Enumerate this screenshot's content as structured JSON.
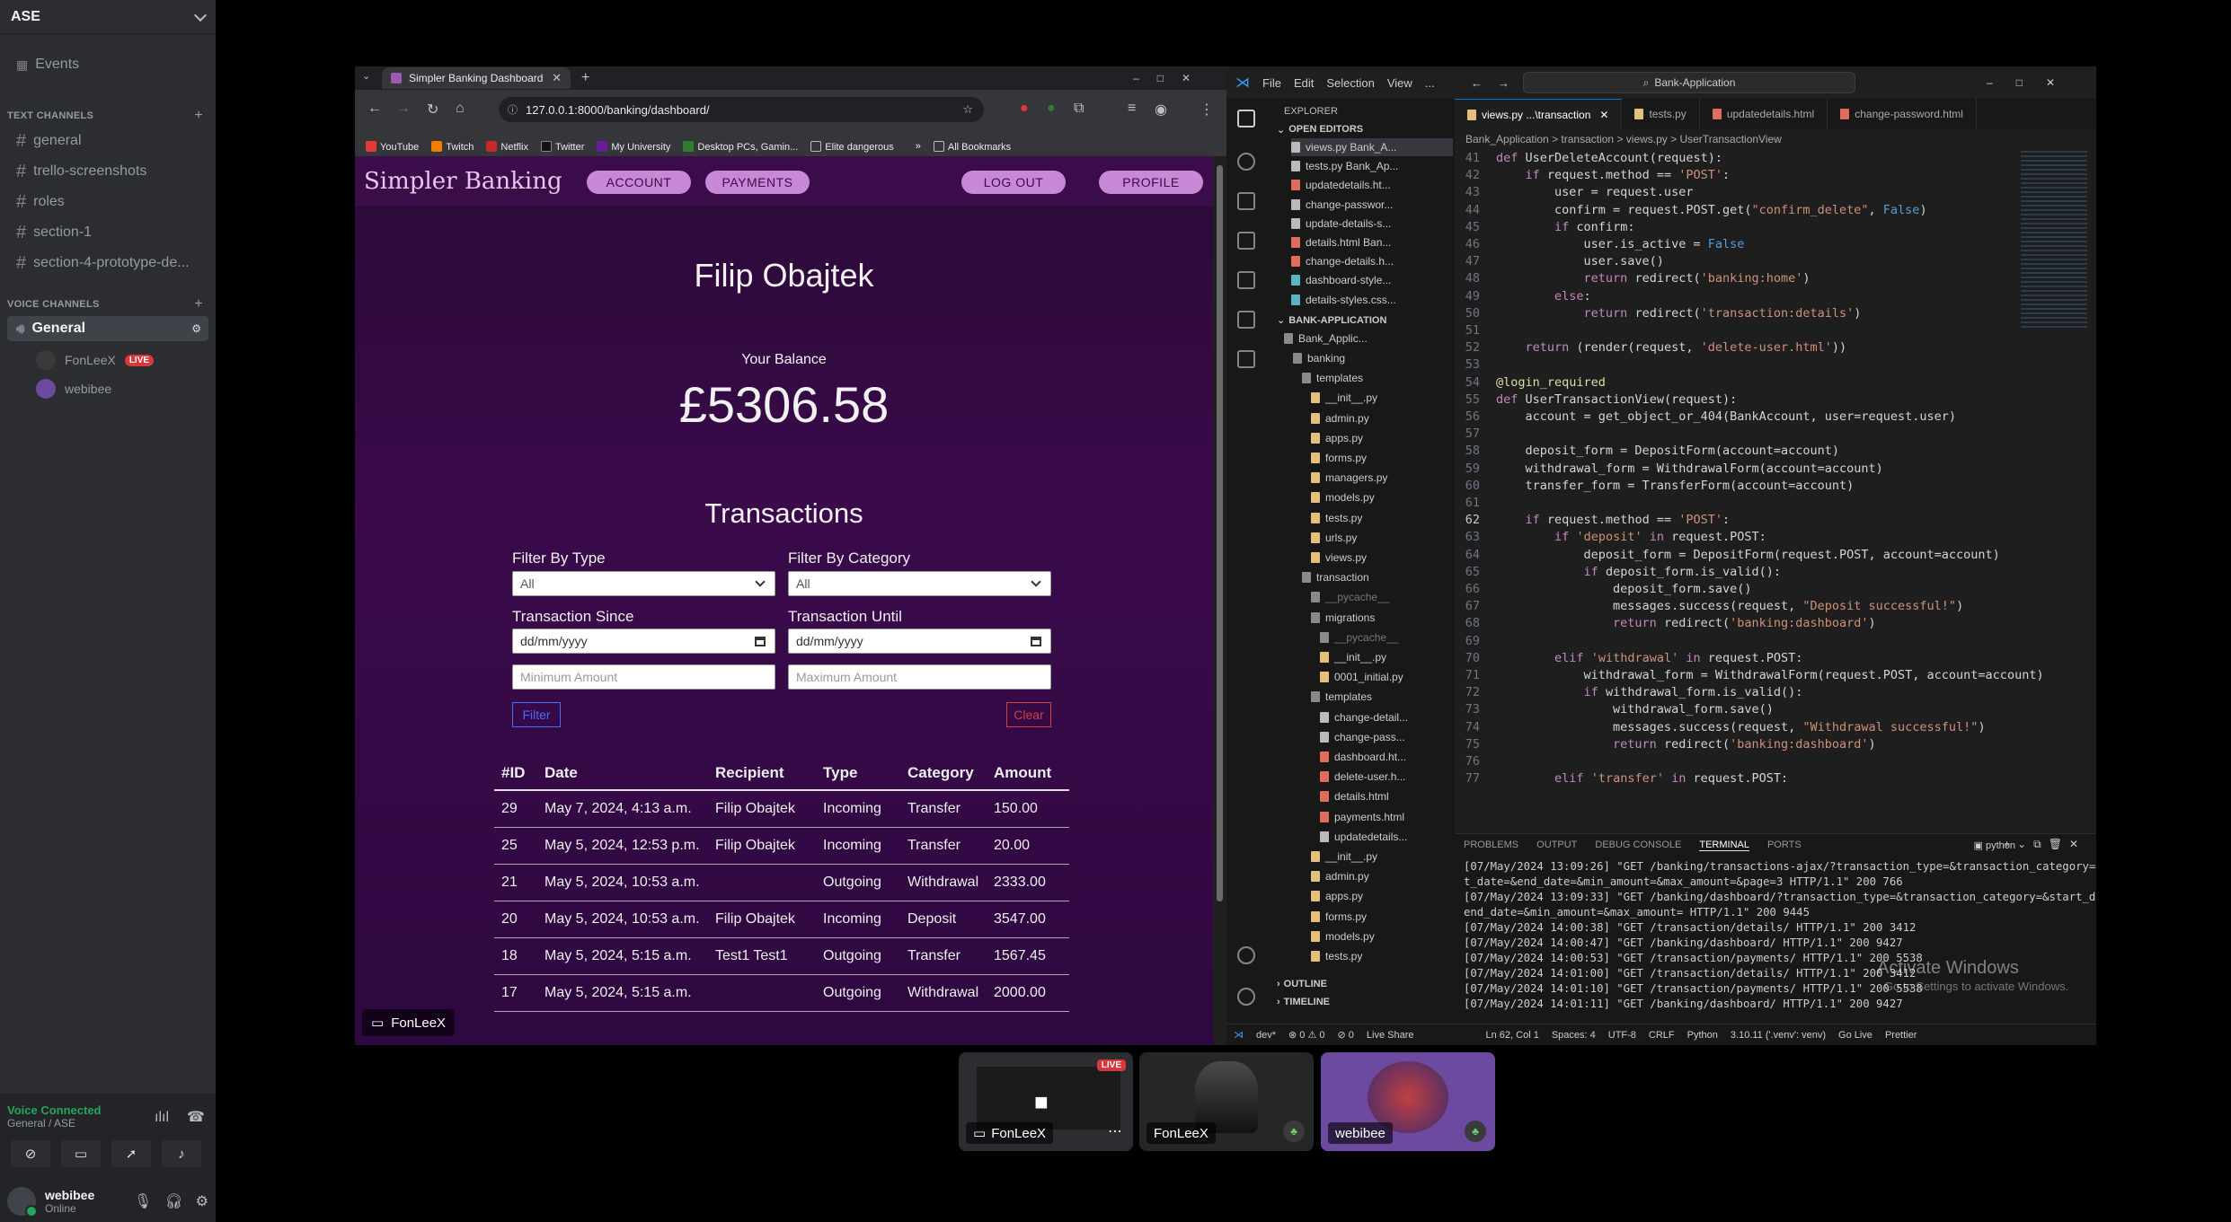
{
  "discord": {
    "server_name": "ASE",
    "events_label": "Events",
    "text_category": "TEXT CHANNELS",
    "text_channels": [
      "general",
      "trello-screenshots",
      "roles",
      "section-1",
      "section-4-prototype-de..."
    ],
    "voice_category": "VOICE CHANNELS",
    "voice_channel": "General",
    "voice_users": [
      {
        "name": "FonLeeX",
        "badge": "LIVE"
      },
      {
        "name": "webibee",
        "badge": ""
      }
    ],
    "voice_connected": "Voice Connected",
    "voice_location": "General / ASE",
    "user": {
      "name": "webibee",
      "status": "Online"
    }
  },
  "browser": {
    "tab_title": "Simpler Banking Dashboard",
    "url": "127.0.0.1:8000/banking/dashboard/",
    "bookmarks": [
      "YouTube",
      "Twitch",
      "Netflix",
      "Twitter",
      "My University",
      "Desktop PCs, Gamin...",
      "Elite dangerous",
      "All Bookmarks"
    ]
  },
  "bank": {
    "brand": "Simpler Banking",
    "nav": {
      "account": "ACCOUNT",
      "payments": "PAYMENTS",
      "logout": "LOG OUT",
      "profile": "PROFILE"
    },
    "user_name": "Filip Obajtek",
    "balance_label": "Your Balance",
    "balance": "£5306.58",
    "transactions_title": "Transactions",
    "filters": {
      "type_label": "Filter By Type",
      "type_value": "All",
      "category_label": "Filter By Category",
      "category_value": "All",
      "since_label": "Transaction Since",
      "until_label": "Transaction Until",
      "date_placeholder": "dd/mm/yyyy",
      "min_placeholder": "Minimum Amount",
      "max_placeholder": "Maximum Amount",
      "filter_btn": "Filter",
      "clear_btn": "Clear"
    },
    "table": {
      "headers": [
        "#ID",
        "Date",
        "Recipient",
        "Type",
        "Category",
        "Amount"
      ],
      "rows": [
        [
          "29",
          "May 7, 2024, 4:13 a.m.",
          "Filip Obajtek",
          "Incoming",
          "Transfer",
          "150.00"
        ],
        [
          "25",
          "May 5, 2024, 12:53 p.m.",
          "Filip Obajtek",
          "Incoming",
          "Transfer",
          "20.00"
        ],
        [
          "21",
          "May 5, 2024, 10:53 a.m.",
          "",
          "Outgoing",
          "Withdrawal",
          "2333.00"
        ],
        [
          "20",
          "May 5, 2024, 10:53 a.m.",
          "Filip Obajtek",
          "Incoming",
          "Deposit",
          "3547.00"
        ],
        [
          "18",
          "May 5, 2024, 5:15 a.m.",
          "Test1 Test1",
          "Outgoing",
          "Transfer",
          "1567.45"
        ],
        [
          "17",
          "May 5, 2024, 5:15 a.m.",
          "",
          "Outgoing",
          "Withdrawal",
          "2000.00"
        ]
      ]
    },
    "streamer_tag": "FonLeeX"
  },
  "vscode": {
    "menu": [
      "File",
      "Edit",
      "Selection",
      "View",
      "..."
    ],
    "search": "Bank-Application",
    "explorer_title": "EXPLORER",
    "open_editors": "OPEN EDITORS",
    "open_files": [
      "views.py Bank_A...",
      "tests.py Bank_Ap...",
      "updatedetails.ht...",
      "change-passwor...",
      "update-details-s...",
      "details.html Ban...",
      "change-details.h...",
      "dashboard-style...",
      "details-styles.css..."
    ],
    "project": "BANK-APPLICATION",
    "tree": [
      "Bank_Applic...",
      "banking",
      "templates",
      "__init__.py",
      "admin.py",
      "apps.py",
      "forms.py",
      "managers.py",
      "models.py",
      "tests.py",
      "urls.py",
      "views.py",
      "transaction",
      "__pycache__",
      "migrations",
      "__pycache__",
      "__init__.py",
      "0001_initial.py",
      "templates",
      "change-detail...",
      "change-pass...",
      "dashboard.ht...",
      "delete-user.h...",
      "details.html",
      "payments.html",
      "updatedetails...",
      "__init__.py",
      "admin.py",
      "apps.py",
      "forms.py",
      "models.py",
      "tests.py"
    ],
    "outline": "OUTLINE",
    "timeline": "TIMELINE",
    "tabs": [
      "views.py ...\\transaction",
      "tests.py",
      "updatedetails.html",
      "change-password.html"
    ],
    "breadcrumbs": "Bank_Application > transaction > views.py > UserTransactionView",
    "code": [
      {
        "n": "41",
        "t": "def UserDeleteAccount(request):"
      },
      {
        "n": "42",
        "t": "    if request.method == 'POST':"
      },
      {
        "n": "43",
        "t": "        user = request.user"
      },
      {
        "n": "44",
        "t": "        confirm = request.POST.get(\"confirm_delete\", False)"
      },
      {
        "n": "45",
        "t": "        if confirm:"
      },
      {
        "n": "46",
        "t": "            user.is_active = False"
      },
      {
        "n": "47",
        "t": "            user.save()"
      },
      {
        "n": "48",
        "t": "            return redirect('banking:home')"
      },
      {
        "n": "49",
        "t": "        else:"
      },
      {
        "n": "50",
        "t": "            return redirect('transaction:details')"
      },
      {
        "n": "51",
        "t": ""
      },
      {
        "n": "52",
        "t": "    return (render(request, 'delete-user.html'))"
      },
      {
        "n": "53",
        "t": ""
      },
      {
        "n": "54",
        "t": "@login_required"
      },
      {
        "n": "55",
        "t": "def UserTransactionView(request):"
      },
      {
        "n": "56",
        "t": "    account = get_object_or_404(BankAccount, user=request.user)"
      },
      {
        "n": "57",
        "t": ""
      },
      {
        "n": "58",
        "t": "    deposit_form = DepositForm(account=account)"
      },
      {
        "n": "59",
        "t": "    withdrawal_form = WithdrawalForm(account=account)"
      },
      {
        "n": "60",
        "t": "    transfer_form = TransferForm(account=account)"
      },
      {
        "n": "61",
        "t": ""
      },
      {
        "n": "62",
        "t": "    if request.method == 'POST':"
      },
      {
        "n": "63",
        "t": "        if 'deposit' in request.POST:"
      },
      {
        "n": "64",
        "t": "            deposit_form = DepositForm(request.POST, account=account)"
      },
      {
        "n": "65",
        "t": "            if deposit_form.is_valid():"
      },
      {
        "n": "66",
        "t": "                deposit_form.save()"
      },
      {
        "n": "67",
        "t": "                messages.success(request, \"Deposit successful!\")"
      },
      {
        "n": "68",
        "t": "                return redirect('banking:dashboard')"
      },
      {
        "n": "69",
        "t": ""
      },
      {
        "n": "70",
        "t": "        elif 'withdrawal' in request.POST:"
      },
      {
        "n": "71",
        "t": "            withdrawal_form = WithdrawalForm(request.POST, account=account)"
      },
      {
        "n": "72",
        "t": "            if withdrawal_form.is_valid():"
      },
      {
        "n": "73",
        "t": "                withdrawal_form.save()"
      },
      {
        "n": "74",
        "t": "                messages.success(request, \"Withdrawal successful!\")"
      },
      {
        "n": "75",
        "t": "                return redirect('banking:dashboard')"
      },
      {
        "n": "76",
        "t": ""
      },
      {
        "n": "77",
        "t": "        elif 'transfer' in request.POST:"
      }
    ],
    "panel_tabs": [
      "PROBLEMS",
      "OUTPUT",
      "DEBUG CONSOLE",
      "TERMINAL",
      "PORTS"
    ],
    "terminal_shell": "python",
    "terminal": [
      "[07/May/2024 13:09:26] \"GET /banking/transactions-ajax/?transaction_type=&transaction_category=&star",
      "t_date=&end_date=&min_amount=&max_amount=&page=3 HTTP/1.1\" 200 766",
      "[07/May/2024 13:09:33] \"GET /banking/dashboard/?transaction_type=&transaction_category=&start_date=&",
      "end_date=&min_amount=&max_amount= HTTP/1.1\" 200 9445",
      "[07/May/2024 14:00:38] \"GET /transaction/details/ HTTP/1.1\" 200 3412",
      "[07/May/2024 14:00:47] \"GET /banking/dashboard/ HTTP/1.1\" 200 9427",
      "[07/May/2024 14:00:53] \"GET /transaction/payments/ HTTP/1.1\" 200 5538",
      "[07/May/2024 14:01:00] \"GET /transaction/details/ HTTP/1.1\" 200 3412",
      "[07/May/2024 14:01:10] \"GET /transaction/payments/ HTTP/1.1\" 200 5538",
      "[07/May/2024 14:01:11] \"GET /banking/dashboard/ HTTP/1.1\" 200 9427"
    ],
    "watermark_title": "Activate Windows",
    "watermark_sub": "Go to Settings to activate Windows.",
    "status": [
      "dev*",
      "⊗ 0 ⚠ 0",
      "⊘ 0",
      "Live Share",
      "Ln 62, Col 1",
      "Spaces: 4",
      "UTF-8",
      "CRLF",
      "Python",
      "3.10.11 ('.venv': venv)",
      "Go Live",
      "Prettier"
    ]
  },
  "tiles": [
    {
      "name": "FonLeeX",
      "badge": "LIVE"
    },
    {
      "name": "FonLeeX",
      "badge": ""
    },
    {
      "name": "webibee",
      "badge": ""
    }
  ]
}
